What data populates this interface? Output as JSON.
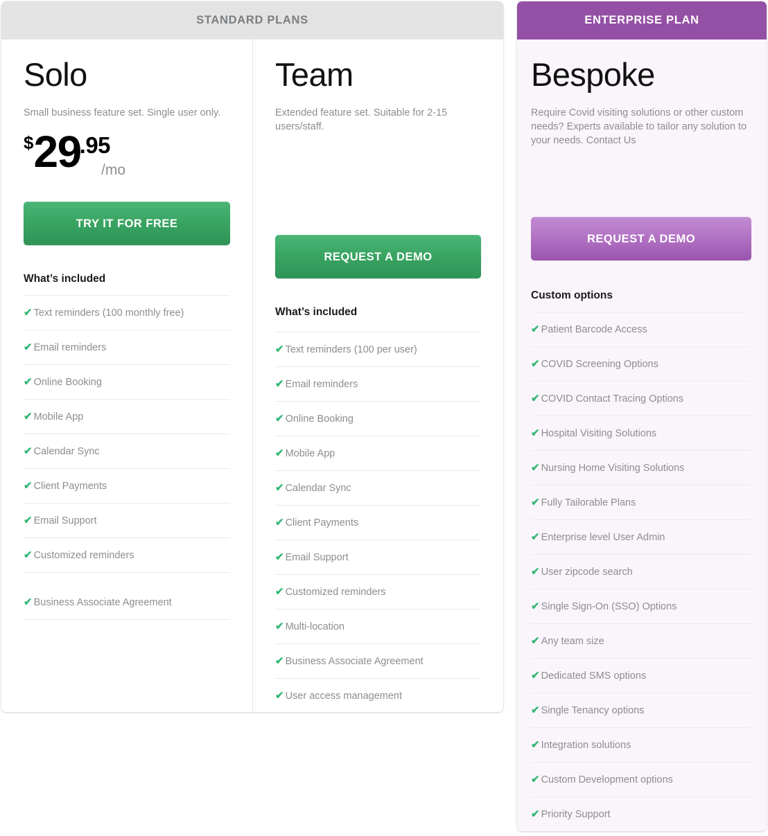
{
  "standard": {
    "header_label": "STANDARD PLANS",
    "columns": [
      {
        "name": "Solo",
        "description": "Small business feature set. Single user only.",
        "price": {
          "currency": "$",
          "amount": "29",
          "cents": ".95",
          "period": "/mo"
        },
        "cta_label": "TRY IT FOR FREE",
        "features_title": "What’s included",
        "features": [
          "Text reminders (100 monthly free)",
          "Email reminders",
          "Online Booking",
          "Mobile App",
          "Calendar Sync",
          "Client Payments",
          "Email Support",
          "Customized reminders",
          "Business Associate Agreement"
        ]
      },
      {
        "name": "Team",
        "description": "Extended feature set. Suitable for 2-15 users/staff.",
        "cta_label": "REQUEST A DEMO",
        "features_title": "What’s included",
        "features": [
          "Text reminders (100 per user)",
          "Email reminders",
          "Online Booking",
          "Mobile App",
          "Calendar Sync",
          "Client Payments",
          "Email Support",
          "Customized reminders",
          "Multi-location",
          "Business Associate Agreement",
          "User access management"
        ]
      }
    ]
  },
  "enterprise": {
    "header_label": "ENTERPRISE PLAN",
    "name": "Bespoke",
    "description": "Require Covid visiting solutions or other custom needs? Experts available to tailor any solution to your needs. Contact Us",
    "cta_label": "REQUEST A DEMO",
    "features_title": "Custom options",
    "features": [
      "Patient Barcode Access",
      "COVID Screening Options",
      "COVID Contact Tracing Options",
      "Hospital Visiting Solutions",
      "Nursing Home Visiting Solutions",
      "Fully Tailorable Plans",
      "Enterprise level User Admin",
      "User zipcode search",
      "Single Sign-On (SSO) Options",
      "Any team size",
      "Dedicated SMS options",
      "Single Tenancy options",
      "Integration solutions",
      "Custom Development options",
      "Priority Support"
    ]
  },
  "icons": {
    "check": "✔"
  },
  "colors": {
    "standard_header_bg": "#e3e3e3",
    "standard_header_text": "#7b7e81",
    "enterprise_header_bg": "#9450a5",
    "enterprise_card_bg": "#faf5fb",
    "green_cta": "#3aa563",
    "purple_cta": "#b272c4",
    "check_green": "#36b877",
    "muted_text": "#8d8d8d"
  }
}
